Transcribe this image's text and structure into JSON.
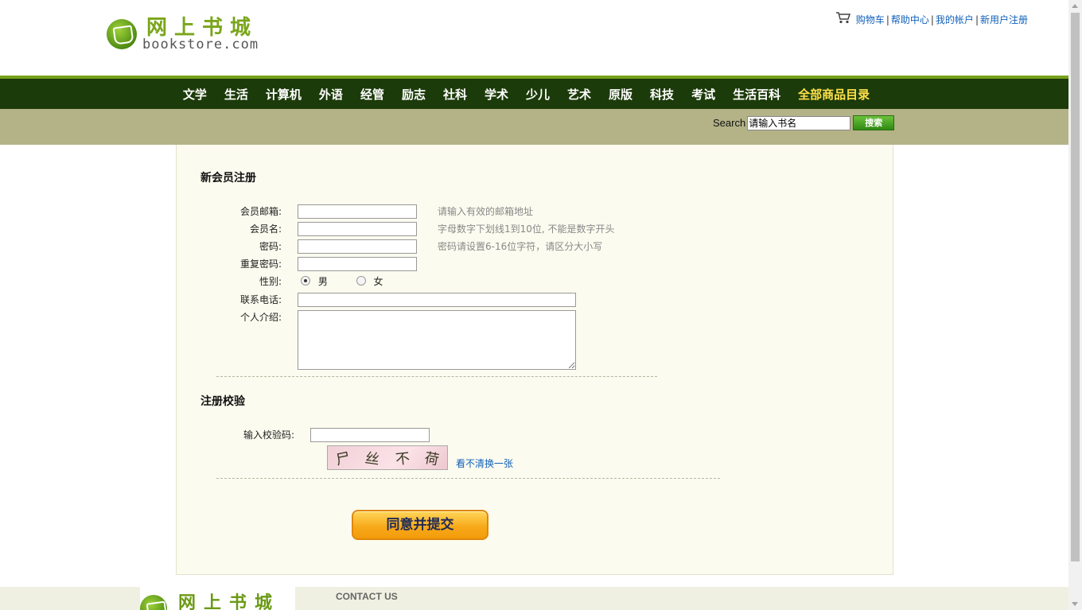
{
  "logo": {
    "cn": "网上书城",
    "en": "bookstore.com"
  },
  "top_links": [
    {
      "label": "购物车"
    },
    {
      "label": "帮助中心"
    },
    {
      "label": "我的帐户"
    },
    {
      "label": "新用户注册"
    }
  ],
  "top_links_sep": "|",
  "nav": {
    "items": [
      "文学",
      "生活",
      "计算机",
      "外语",
      "经管",
      "励志",
      "社科",
      "学术",
      "少儿",
      "艺术",
      "原版",
      "科技",
      "考试",
      "生活百科"
    ],
    "highlight": "全部商品目录"
  },
  "search": {
    "label": "Search",
    "value": "请输入书名",
    "button": "搜索"
  },
  "register": {
    "title": "新会员注册",
    "email_label": "会员邮箱:",
    "email_hint": "请输入有效的邮箱地址",
    "username_label": "会员名:",
    "username_hint": "字母数字下划线1到10位, 不能是数字开头",
    "password_label": "密码:",
    "password_hint": "密码请设置6-16位字符，请区分大小写",
    "repeat_label": "重复密码:",
    "gender_label": "性别:",
    "gender_male": "男",
    "gender_female": "女",
    "phone_label": "联系电话:",
    "intro_label": "个人介绍:"
  },
  "verify": {
    "title": "注册校验",
    "code_label": "输入校验码:",
    "captcha_chars": [
      "尸",
      "丝",
      "不",
      "荷"
    ],
    "refresh": "看不清换一张"
  },
  "submit": "同意并提交",
  "footer": {
    "logo_cn": "网上书城",
    "contact": "CONTACT US"
  },
  "colors": {
    "nav_bg": "#1c3b0a",
    "accent_green": "#76a11b",
    "link": "#1160b9",
    "highlight": "#ffe14a"
  }
}
